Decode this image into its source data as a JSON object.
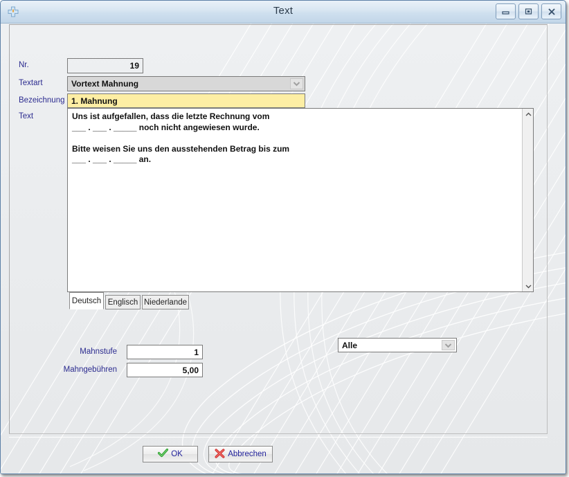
{
  "window": {
    "title": "Text",
    "app_icon": "plus-cross-icon",
    "controls": [
      {
        "name": "minimize-button",
        "icon": "minimize-icon"
      },
      {
        "name": "restore-button",
        "icon": "restore-icon"
      },
      {
        "name": "close-button",
        "icon": "close-icon"
      }
    ]
  },
  "form": {
    "nr": {
      "label": "Nr.",
      "value": "19"
    },
    "textart": {
      "label": "Textart",
      "value": "Vortext Mahnung",
      "icon": "chevron-down-icon"
    },
    "bezeichnung": {
      "label": "Bezeichnung",
      "value": "1. Mahnung"
    },
    "text": {
      "label": "Text",
      "value": "Uns ist aufgefallen, dass die letzte Rechnung vom\n___ . ___ . _____ noch nicht angewiesen wurde.\n\nBitte weisen Sie uns den ausstehenden Betrag bis zum\n___ . ___ . _____ an."
    },
    "mahnstufe": {
      "label": "Mahnstufe",
      "value": "1"
    },
    "mahngebuehren": {
      "label": "Mahngebühren",
      "value": "5,00"
    },
    "filter": {
      "value": "Alle",
      "icon": "chevron-down-icon"
    }
  },
  "tabs": [
    {
      "label": "Deutsch",
      "active": true
    },
    {
      "label": "Englisch",
      "active": false
    },
    {
      "label": "Niederlande",
      "active": false
    }
  ],
  "footer": {
    "ok": {
      "label": "OK",
      "icon": "green-check-icon"
    },
    "cancel": {
      "label": "Abbrechen",
      "icon": "red-x-icon"
    }
  },
  "colors": {
    "label_blue": "#2b2b8f",
    "highlight_yellow": "#fdeea4",
    "titlebar_blue": "#cfe0ef",
    "ok_green": "#2aa02a",
    "cancel_red": "#d32f2f"
  }
}
